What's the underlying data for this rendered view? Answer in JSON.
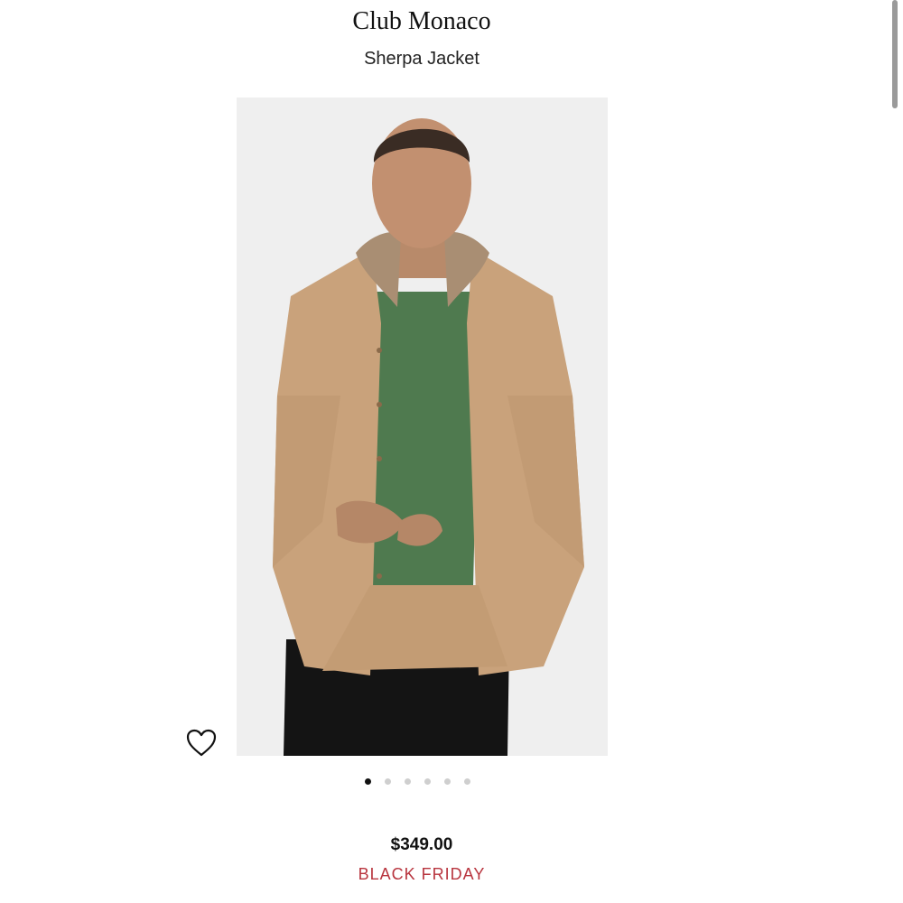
{
  "product": {
    "brand": "Club Monaco",
    "name": "Sherpa Jacket",
    "price": "$349.00",
    "promo_label": "BLACK FRIDAY"
  },
  "carousel": {
    "total_images": 6,
    "active_index": 0
  },
  "icons": {
    "wishlist": "heart-outline-icon"
  },
  "colors": {
    "promo": "#b8343e",
    "dot_active": "#111111",
    "dot_inactive": "#cfcfcf"
  }
}
